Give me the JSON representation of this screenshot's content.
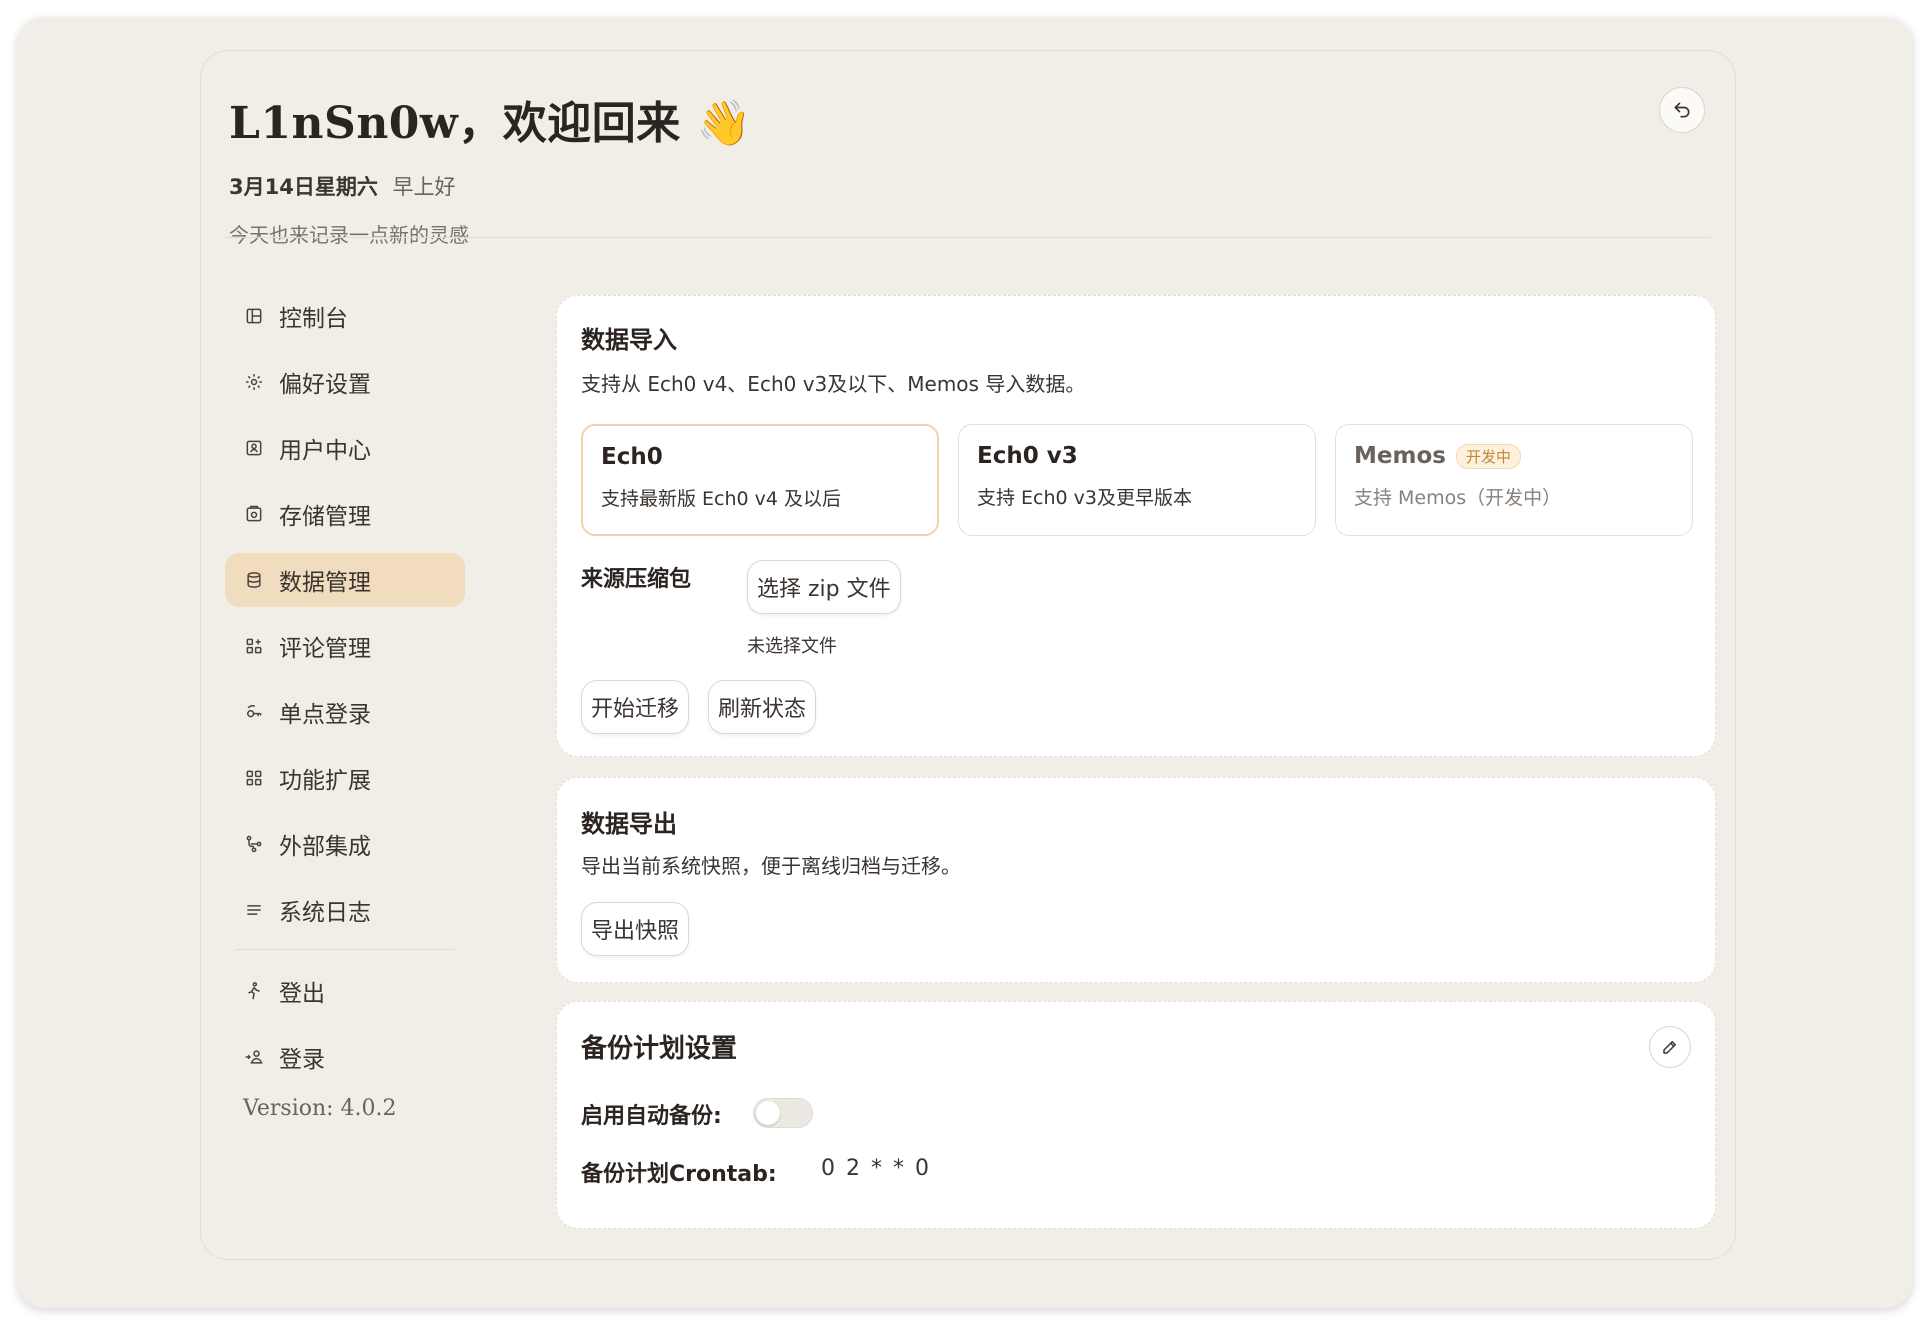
{
  "header": {
    "greeting": "L1nSn0w，欢迎回来 👋",
    "date": "3月14日星期六",
    "time_of_day": "早上好",
    "subtitle": "今天也来记录一点新的灵感"
  },
  "sidebar": {
    "items": [
      {
        "label": "控制台",
        "icon": "dashboard-icon"
      },
      {
        "label": "偏好设置",
        "icon": "gear-icon"
      },
      {
        "label": "用户中心",
        "icon": "user-card-icon"
      },
      {
        "label": "存储管理",
        "icon": "storage-icon"
      },
      {
        "label": "数据管理",
        "icon": "database-icon",
        "active": true
      },
      {
        "label": "评论管理",
        "icon": "grid-icon"
      },
      {
        "label": "单点登录",
        "icon": "key-icon"
      },
      {
        "label": "功能扩展",
        "icon": "grid-plus-icon"
      },
      {
        "label": "外部集成",
        "icon": "branch-icon"
      },
      {
        "label": "系统日志",
        "icon": "list-icon"
      }
    ],
    "bottom_items": [
      {
        "label": "登出",
        "icon": "walk-icon"
      },
      {
        "label": "登录",
        "icon": "login-icon"
      }
    ],
    "version": "Version: 4.0.2"
  },
  "import_card": {
    "title": "数据导入",
    "description": "支持从 Ech0 v4、Ech0 v3及以下、Memos 导入数据。",
    "sources": [
      {
        "name": "Ech0",
        "desc": "支持最新版 Ech0 v4 及以后",
        "selected": true
      },
      {
        "name": "Ech0 v3",
        "desc": "支持 Ech0 v3及更早版本"
      },
      {
        "name": "Memos",
        "badge": "开发中",
        "desc": "支持 Memos（开发中）"
      }
    ],
    "zip_label": "来源压缩包",
    "choose_file_button": "选择 zip 文件",
    "no_file_text": "未选择文件",
    "start_button": "开始迁移",
    "refresh_button": "刷新状态"
  },
  "export_card": {
    "title": "数据导出",
    "description": "导出当前系统快照，便于离线归档与迁移。",
    "export_button": "导出快照"
  },
  "backup_card": {
    "title": "备份计划设置",
    "auto_backup_label": "启用自动备份:",
    "auto_backup_enabled": false,
    "crontab_label": "备份计划Crontab:",
    "crontab_value": "0 2 * * 0"
  },
  "colors": {
    "background": "#f1eee7",
    "active_nav": "#f2dcc0",
    "selected_border": "#f3d3ac",
    "badge_text": "#c08a3e"
  }
}
